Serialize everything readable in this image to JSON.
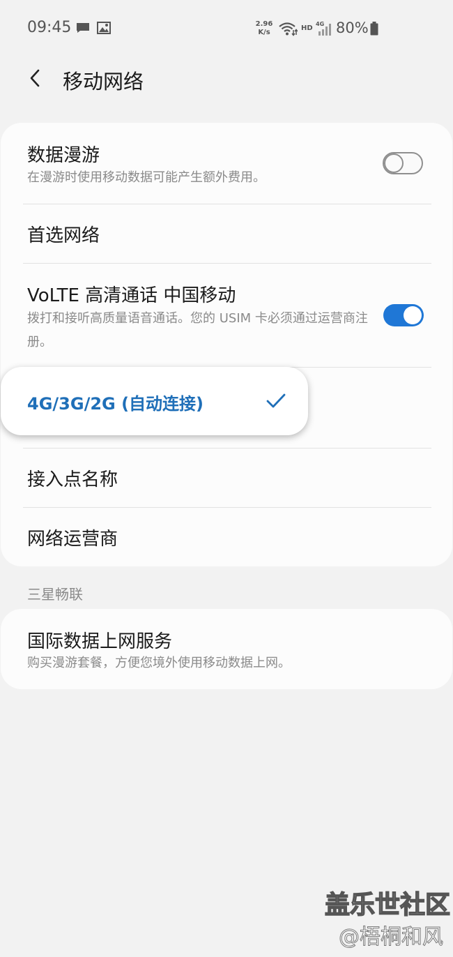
{
  "status_bar": {
    "time": "09:45",
    "speed_value": "2.96",
    "speed_unit": "K/s",
    "hd_label": "HD",
    "network_label": "4G",
    "battery": "80%"
  },
  "header": {
    "title": "移动网络"
  },
  "settings": {
    "data_roaming": {
      "title": "数据漫游",
      "subtitle": "在漫游时使用移动数据可能产生额外费用。",
      "enabled": false
    },
    "preferred_network": {
      "title": "首选网络"
    },
    "volte": {
      "title": "VoLTE 高清通话 中国移动",
      "subtitle": "拨打和接听高质量语音通话。您的 USIM 卡必须通过运营商注册。",
      "enabled": true
    },
    "apn": {
      "title": "接入点名称"
    },
    "operator": {
      "title": "网络运营商"
    }
  },
  "network_popup": {
    "selected_option": "4G/3G/2G (自动连接)"
  },
  "samsung_section": {
    "header": "三星畅联",
    "intl_data": {
      "title": "国际数据上网服务",
      "subtitle": "购买漫游套餐，方便您境外使用移动数据上网。"
    }
  },
  "watermark": {
    "line1": "盖乐世社区",
    "line2": "@梧桐和风"
  },
  "colors": {
    "accent": "#1f77d6",
    "popup_text": "#1f6fb8",
    "background": "#f2f2f2",
    "card": "#fcfcfc"
  },
  "icons": [
    "message-icon",
    "image-icon",
    "wifi-icon",
    "signal-icon",
    "battery-icon",
    "back-arrow-icon",
    "check-icon"
  ]
}
